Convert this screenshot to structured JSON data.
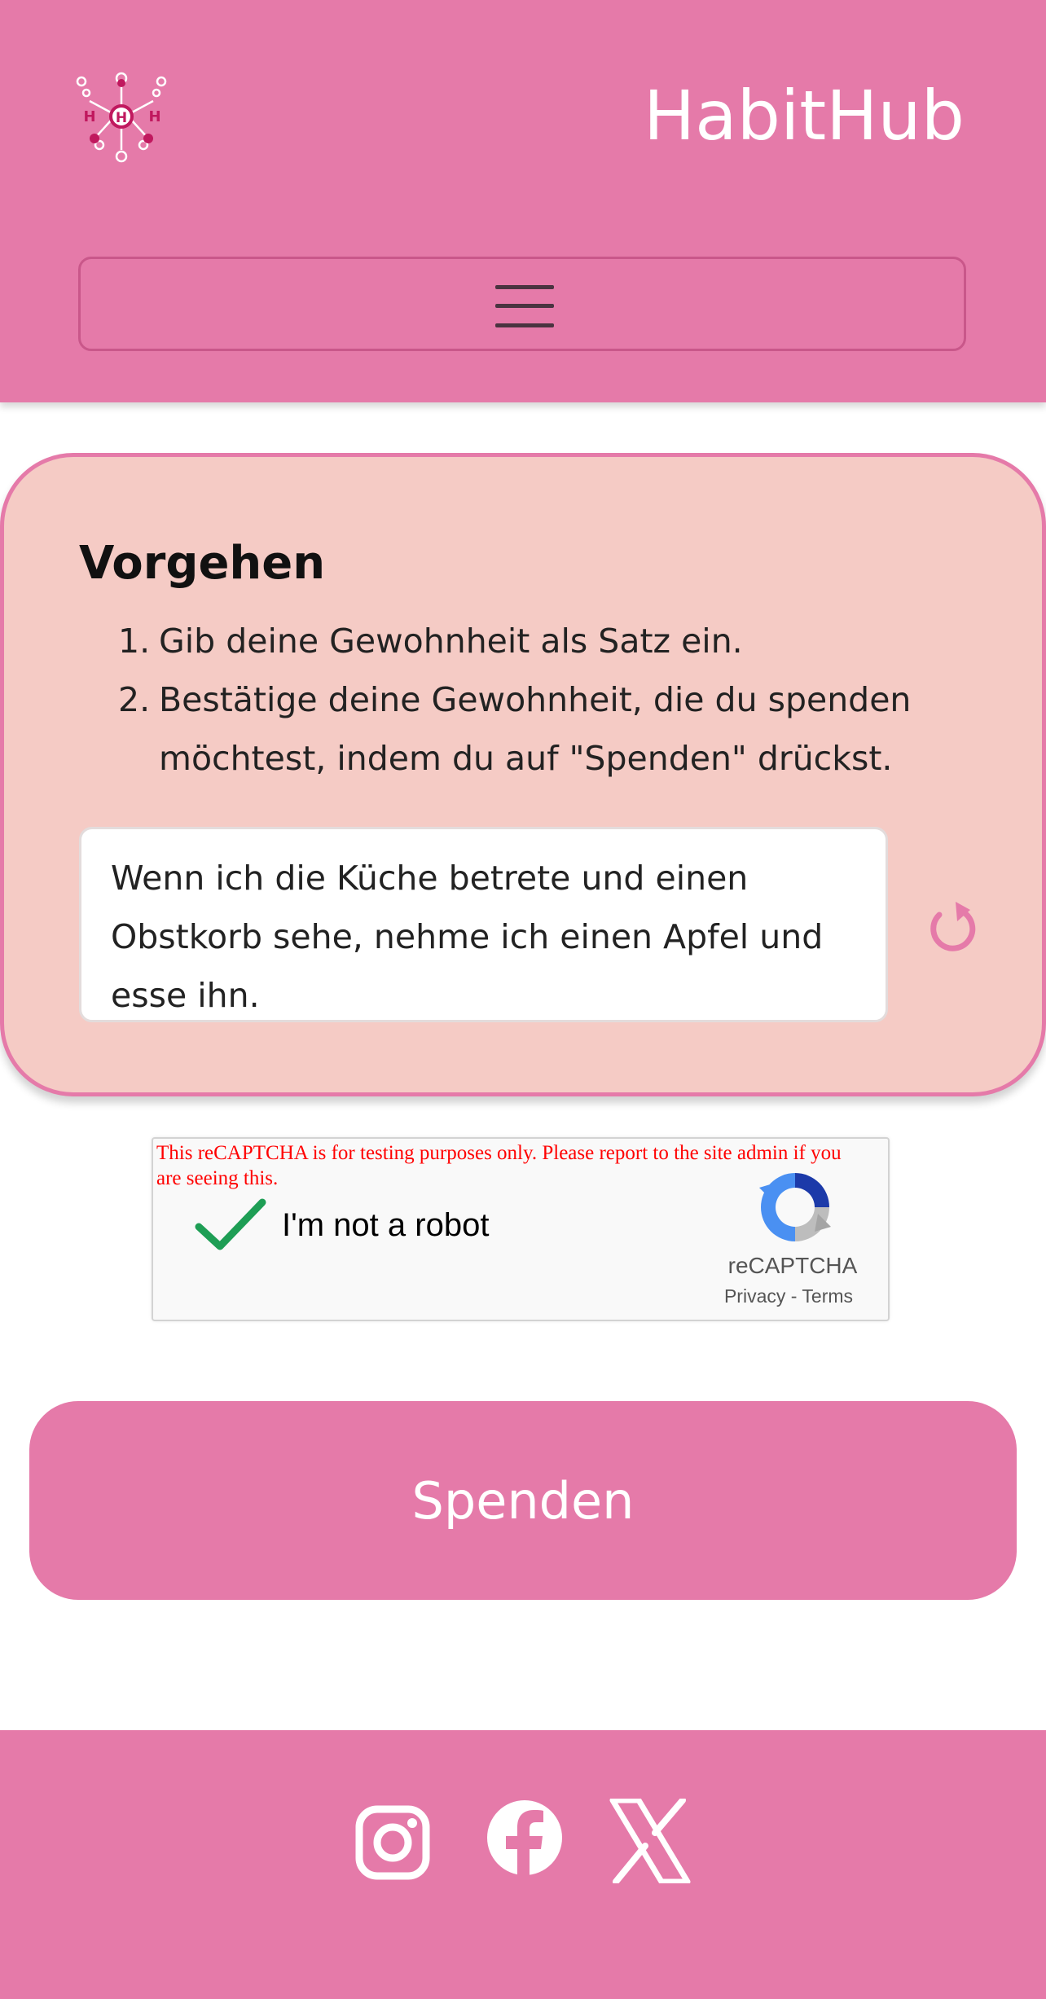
{
  "header": {
    "brand": "HabitHub",
    "logo_letters": [
      "H",
      "H",
      "H"
    ],
    "menu_icon": "hamburger-icon"
  },
  "card": {
    "title": "Vorgehen",
    "steps": [
      {
        "num": "1.",
        "text": "Gib deine Gewohnheit als Satz ein."
      },
      {
        "num": "2.",
        "text": "Bestätige deine Gewohnheit, die du spenden möchtest, indem du auf \"Spenden\" drückst."
      }
    ],
    "habit_text": "Wenn ich die Küche betrete und einen Obstkorb sehe, nehme ich einen Apfel und esse ihn.",
    "reset_icon": "refresh-icon"
  },
  "captcha": {
    "warning": "This reCAPTCHA is for testing purposes only. Please report to the site admin if you are seeing this.",
    "label": "I'm not a robot",
    "brand": "reCAPTCHA",
    "privacy": "Privacy",
    "separator": "-",
    "terms": "Terms",
    "checked": true
  },
  "donate_button": {
    "label": "Spenden"
  },
  "footer": {
    "icons": [
      "instagram-icon",
      "facebook-icon",
      "x-icon"
    ]
  },
  "colors": {
    "primary": "#e57aa9",
    "card_bg": "#f5cbc5",
    "card_border": "#e57aa9",
    "captcha_warning": "#ff0000",
    "check_green": "#1e9e55"
  }
}
